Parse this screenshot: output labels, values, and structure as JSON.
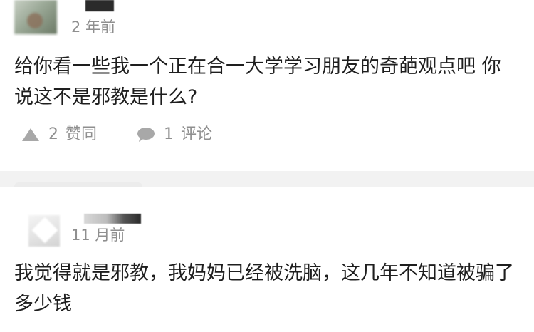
{
  "comments": [
    {
      "timestamp": "2 年前",
      "text": "给你看一些我一个正在合一大学学习朋友的奇葩观点吧 你说这不是邪教是什么?",
      "actions": {
        "like_count": "2",
        "like_label": "赞同",
        "like_icon": "triangle-up-icon",
        "comment_count": "1",
        "comment_label": "评论",
        "comment_icon": "speech-bubble-icon"
      }
    },
    {
      "timestamp": "11 月前",
      "text": "我觉得就是邪教，我妈妈已经被洗脑，这几年不知道被骗了多少钱"
    }
  ],
  "colors": {
    "page_background": "#f2f2f2",
    "card_background": "#ffffff",
    "text_primary": "#1e1e1e",
    "text_secondary": "#8f8f8f"
  }
}
